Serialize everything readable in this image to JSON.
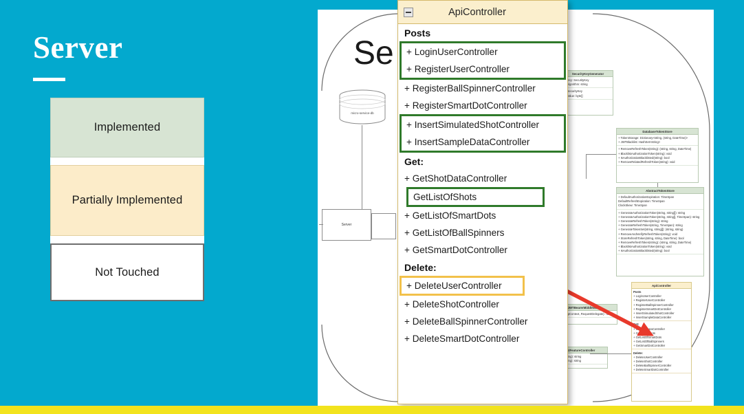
{
  "slide": {
    "title": "Server",
    "background_color": "#03a9ce",
    "accent_bar_color": "#f2e31d",
    "ghost_heading": "Se"
  },
  "legend": {
    "items": [
      {
        "label": "Implemented",
        "color": "#d7e4d3",
        "border": "#bfcfba"
      },
      {
        "label": "Partially Implemented",
        "color": "#fcecc9",
        "border": "#e2cf9f"
      },
      {
        "label": "Not Touched",
        "color": "#ffffff",
        "border": "#6e6e6e"
      }
    ]
  },
  "api_panel": {
    "title": "ApiController",
    "collapse_icon": "minimize-icon",
    "header_color": "#fbefcd",
    "border_color": "#d4b96a",
    "highlight_green": "#2f7a2a",
    "highlight_yellow": "#f2c14a",
    "groups": [
      {
        "label": "Posts",
        "entries": [
          {
            "text": "+ LoginUserController",
            "highlight": "green-group-1"
          },
          {
            "text": "+ RegisterUserController",
            "highlight": "green-group-1"
          },
          {
            "text": "+ RegisterBallSpinnerController",
            "highlight": "none"
          },
          {
            "text": "+ RegisterSmartDotController",
            "highlight": "none"
          },
          {
            "text": "+ InsertSimulatedShotController",
            "highlight": "green-group-2"
          },
          {
            "text": "+ InsertSampleDataController",
            "highlight": "green-group-2"
          }
        ]
      },
      {
        "label": "Get:",
        "entries": [
          {
            "text": "+ GetShotDataController",
            "highlight": "none"
          },
          {
            "text": "GetListOfShots",
            "highlight": "green-inline"
          },
          {
            "text": "+ GetListOfSmartDots",
            "highlight": "none"
          },
          {
            "text": "+ GetListOfBallSpinners",
            "highlight": "none"
          },
          {
            "text": "+ GetSmartDotController",
            "highlight": "none"
          }
        ]
      },
      {
        "label": "Delete:",
        "entries": [
          {
            "text": "+ DeleteUserController",
            "highlight": "yellow"
          },
          {
            "text": "+ DeleteShotController",
            "highlight": "none"
          },
          {
            "text": "+ DeleteBallSpinnerController",
            "highlight": "none"
          },
          {
            "text": "+ DeleteSmartDotController",
            "highlight": "none"
          }
        ]
      }
    ]
  },
  "background_diagram": {
    "server_box_label": "Server",
    "database_label": "micro-service-db",
    "classes": [
      {
        "name": "DatabaseTokenStore",
        "style": "green",
        "attributes": [
          "+ TokenStorage: Dictionary<string, (string, DateTime)>",
          "+ JWTBlacklist: HashSet<string>"
        ],
        "methods": [
          "+ RemoveRefreshToken(string): (string, string, DateTime)",
          "+ BlacklistAuthorizationToken(string): void",
          "+ IsAuthorizationBlacklisted(string): bool",
          "+ RemoveRelatedRefreshToken(string): void"
        ]
      },
      {
        "name": "AbstractTokenStore",
        "style": "green",
        "attributes": [
          "+ DefaultAuthorizationExpiration: TimeSpan",
          "DefaultRefreshExpiration: TimeSpan",
          "ClockSkew: TimeSpan"
        ],
        "methods": [
          "+ GenerateAuthorizationToken(string, string[]): string",
          "+ GenerateAuthorizationToken(string, string[], TimeSpan): string",
          "+ GenerateRefreshToken(string): string",
          "+ GenerateRefreshToken(string, TimeSpan): string",
          "+ GenerateTokenSet(string, string[]): (string, string)",
          "+ RemoveAndVerifyRefreshToken(string): void",
          "+ StoreRefreshToken(string, string, DateTime): bool",
          "+ RemoveRefreshToken(string): (string, string, DateTime)",
          "+ BlacklistAuthorizationToken(string): void",
          "+ IsAuthorizationBlacklisted(string): bool"
        ]
      },
      {
        "name": "JWTBearerMiddleware",
        "style": "green",
        "attributes": [],
        "methods": [
          "+ Invoke(HttpContext, RequestDelegate): Task"
        ]
      },
      {
        "name": "AbstractFeatureController",
        "style": "green",
        "attributes": [],
        "methods": [
          "+ GetFeature(string): string",
          "+ SetFeature(string): string"
        ]
      },
      {
        "name": "SecurityKeyGenerator",
        "style": "green",
        "attributes": [
          "+ Key: SecurityKey",
          "+ Algorithm: string",
          "+ SecurityKey",
          "+ Value: byte[]"
        ],
        "methods": []
      },
      {
        "name": "ApiController",
        "style": "yellow",
        "groups": [
          {
            "label": "Posts",
            "entries": [
              "+ LoginUserController",
              "+ RegisterUserController",
              "+ RegisterBallSpinnerController",
              "+ RegisterSmartDotController",
              "+ InsertSimulatedShotController",
              "+ InsertSampleDataController"
            ]
          },
          {
            "label": "Get:",
            "entries": [
              "+ GetShotDataController",
              "+ GetListOfShots",
              "+ GetListOfSmartDots",
              "+ GetListOfBallSpinners",
              "+ GetSmartDotController"
            ]
          },
          {
            "label": "Delete:",
            "entries": [
              "+ DeleteUserController",
              "+ DeleteShotController",
              "+ DeleteBallSpinnerController",
              "+ DeleteSmartDotController"
            ]
          }
        ]
      }
    ],
    "callout_arrow": {
      "color": "#e8392b",
      "name": "zoom-callout-arrow"
    }
  }
}
